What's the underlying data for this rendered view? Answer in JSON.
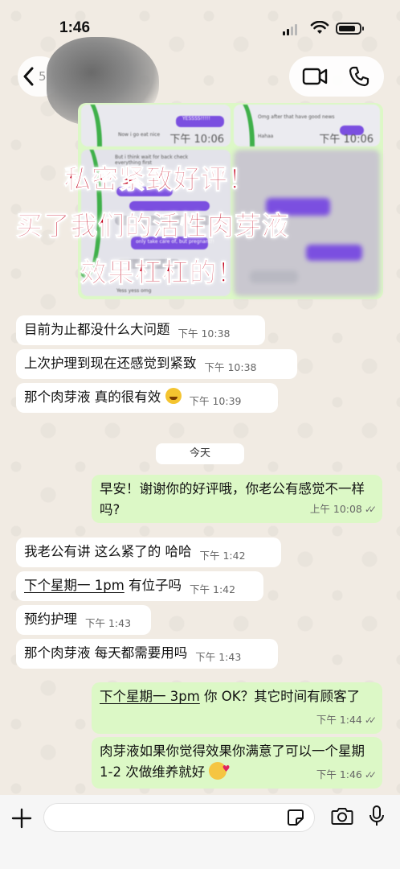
{
  "status_bar": {
    "time": "1:46"
  },
  "header": {
    "back_count": "5"
  },
  "image_grid": {
    "tile1": {
      "timestamp": "下午 10:06",
      "snippet_a": "Now i go eat nice",
      "snippet_b": "YESSSS!!!!!"
    },
    "tile2": {
      "timestamp": "下午 10:06",
      "snippet_a": "Omg after that have good news",
      "snippet_b": "Hahaa"
    },
    "tile3": {
      "snippet_a": "But i think wait for back check everything first",
      "snippet_b": "Yess yess omg",
      "snippet_c": "only take care of, but pregnant!!"
    },
    "promo_lines": [
      "私密紧致好评！",
      "买了我们的活性肉芽液",
      "效果杠杠的！"
    ]
  },
  "messages": [
    {
      "dir": "in",
      "text": "目前为止都没什么大问题",
      "time": "下午 10:38"
    },
    {
      "dir": "in",
      "text": "上次护理到现在还感觉到紧致",
      "time": "下午 10:38"
    },
    {
      "dir": "in",
      "text": "那个肉芽液 真的很有效",
      "time": "下午 10:39",
      "emoji": "joy"
    },
    {
      "dir": "out",
      "text": "早安！谢谢你的好评哦，你老公有感觉不一样吗?",
      "time": "上午 10:08"
    },
    {
      "dir": "in",
      "text": "我老公有讲 这么紧了的 哈哈",
      "time": "下午 1:42"
    },
    {
      "dir": "in",
      "text_link": "下个星期一 1pm",
      "text_rest": " 有位子吗",
      "time": "下午 1:42"
    },
    {
      "dir": "in",
      "text": "预约护理",
      "time": "下午 1:43"
    },
    {
      "dir": "in",
      "text": "那个肉芽液 每天都需要用吗",
      "time": "下午 1:43"
    },
    {
      "dir": "out",
      "text_link": "下个星期一 3pm",
      "text_rest": " 你 OK？其它时间有顾客了",
      "time": "下午 1:44"
    },
    {
      "dir": "out",
      "text": "肉芽液如果你觉得效果你满意了可以一个星期 1-2 次做维养就好",
      "time": "下午 1:46",
      "emoji": "love"
    }
  ],
  "date_separator": "今天",
  "icons": {
    "back": "chevron-left-icon",
    "video": "video-call-icon",
    "phone": "phone-icon",
    "attach": "plus-icon",
    "sticker": "sticker-icon",
    "camera": "camera-icon",
    "mic": "microphone-icon",
    "read": "double-check-icon"
  },
  "colors": {
    "out_bubble": "#dcf8c6",
    "in_bubble": "#ffffff",
    "promo_text": "#c4001b"
  }
}
